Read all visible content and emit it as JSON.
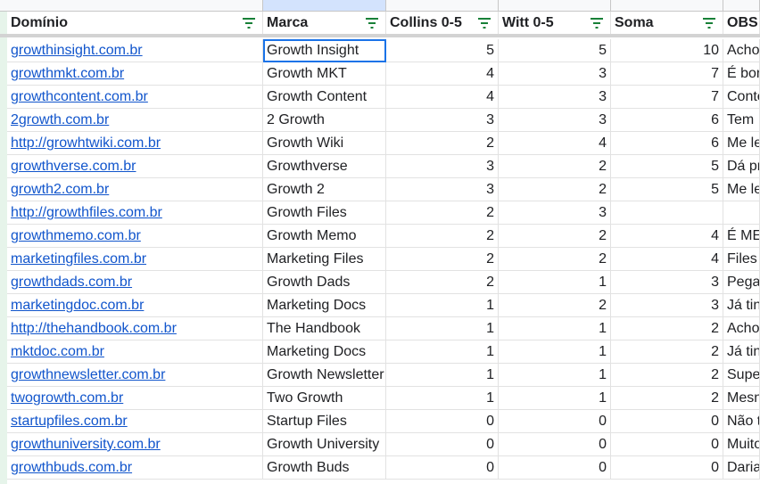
{
  "sheet": {
    "headers": [
      "Domínio",
      "Marca",
      "Collins 0-5",
      "Witt 0-5",
      "Soma",
      "OBS"
    ],
    "rows": [
      {
        "dominio": "growthinsight.com.br",
        "marca": "Growth Insight",
        "collins": "5",
        "witt": "5",
        "soma": "10",
        "obs": "Acho"
      },
      {
        "dominio": "growthmkt.com.br",
        "marca": "Growth MKT",
        "collins": "4",
        "witt": "3",
        "soma": "7",
        "obs": "É bom"
      },
      {
        "dominio": "growthcontent.com.br",
        "marca": "Growth Content",
        "collins": "4",
        "witt": "3",
        "soma": "7",
        "obs": "Conte"
      },
      {
        "dominio": "2growth.com.br",
        "marca": "2 Growth",
        "collins": "3",
        "witt": "3",
        "soma": "6",
        "obs": "Tem"
      },
      {
        "dominio": "http://growhtwiki.com.br",
        "marca": "Growth Wiki",
        "collins": "2",
        "witt": "4",
        "soma": "6",
        "obs": "Me le"
      },
      {
        "dominio": "growthverse.com.br",
        "marca": "Growthverse",
        "collins": "3",
        "witt": "2",
        "soma": "5",
        "obs": "Dá pr"
      },
      {
        "dominio": "growth2.com.br",
        "marca": "Growth 2",
        "collins": "3",
        "witt": "2",
        "soma": "5",
        "obs": "Me le"
      },
      {
        "dominio": "http://growthfiles.com.br",
        "marca": "Growth Files",
        "collins": "2",
        "witt": "3",
        "soma": "",
        "obs": ""
      },
      {
        "dominio": "growthmemo.com.br",
        "marca": "Growth Memo",
        "collins": "2",
        "witt": "2",
        "soma": "4",
        "obs": "É ME"
      },
      {
        "dominio": "marketingfiles.com.br",
        "marca": "Marketing Files",
        "collins": "2",
        "witt": "2",
        "soma": "4",
        "obs": "Files"
      },
      {
        "dominio": "growthdads.com.br",
        "marca": "Growth Dads",
        "collins": "2",
        "witt": "1",
        "soma": "3",
        "obs": "Pega"
      },
      {
        "dominio": "marketingdoc.com.br",
        "marca": "Marketing Docs",
        "collins": "1",
        "witt": "2",
        "soma": "3",
        "obs": "Já tin"
      },
      {
        "dominio": "http://thehandbook.com.br",
        "marca": "The Handbook",
        "collins": "1",
        "witt": "1",
        "soma": "2",
        "obs": "Acho"
      },
      {
        "dominio": "mktdoc.com.br",
        "marca": "Marketing Docs",
        "collins": "1",
        "witt": "1",
        "soma": "2",
        "obs": "Já tin"
      },
      {
        "dominio": "growthnewsletter.com.br",
        "marca": "Growth Newsletter",
        "collins": "1",
        "witt": "1",
        "soma": "2",
        "obs": "Supe"
      },
      {
        "dominio": "twogrowth.com.br",
        "marca": "Two Growth",
        "collins": "1",
        "witt": "1",
        "soma": "2",
        "obs": "Mesn"
      },
      {
        "dominio": "startupfiles.com.br",
        "marca": "Startup Files",
        "collins": "0",
        "witt": "0",
        "soma": "0",
        "obs": "Não t"
      },
      {
        "dominio": "growthuniversity.com.br",
        "marca": "Growth University",
        "collins": "0",
        "witt": "0",
        "soma": "0",
        "obs": "Muito"
      },
      {
        "dominio": "growthbuds.com.br",
        "marca": "Growth Buds",
        "collins": "0",
        "witt": "0",
        "soma": "0",
        "obs": "Daria"
      }
    ]
  },
  "colors": {
    "link": "#1155cc",
    "filter_icon": "#188038",
    "active_cell_border": "#1a73e8",
    "selected_column_header": "#d3e3fd"
  }
}
